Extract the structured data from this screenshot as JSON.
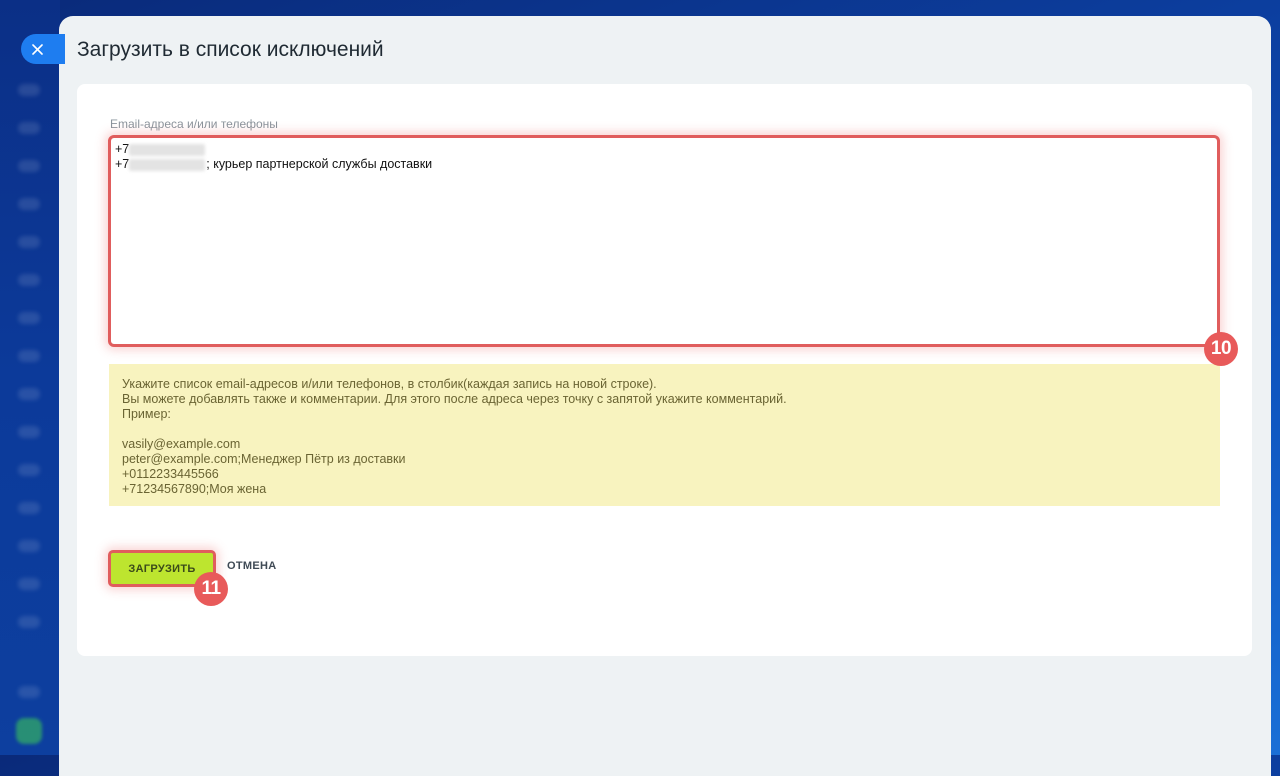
{
  "dialog": {
    "title": "Загрузить в список исключений"
  },
  "form": {
    "field_label": "Email-адреса и/или телефоны",
    "textarea_lines": [
      {
        "prefix": "+7",
        "suffix": ""
      },
      {
        "prefix": "+7",
        "suffix": "; курьер партнерской службы доставки"
      }
    ],
    "hint": {
      "line1": "Укажите список email-адресов и/или телефонов, в столбик(каждая запись на новой строке).",
      "line2": "Вы можете добавлять также и комментарии. Для этого после адреса через точку с запятой укажите комментарий.",
      "line3": "Пример:",
      "examples": [
        "vasily@example.com",
        "peter@example.com;Менеджер Пётр из доставки",
        "+0112233445566",
        "+71234567890;Моя жена"
      ]
    }
  },
  "buttons": {
    "upload_label": "ЗАГРУЗИТЬ",
    "cancel_label": "ОТМЕНА"
  },
  "annotations": {
    "badge_textarea": "10",
    "badge_button": "11"
  },
  "colors": {
    "accent_highlight": "#e05d5d",
    "upload_button": "#bde52f",
    "hint_background": "#f8f3bf",
    "close_button": "#1e7df0"
  },
  "icons": {
    "close": "close-icon"
  }
}
